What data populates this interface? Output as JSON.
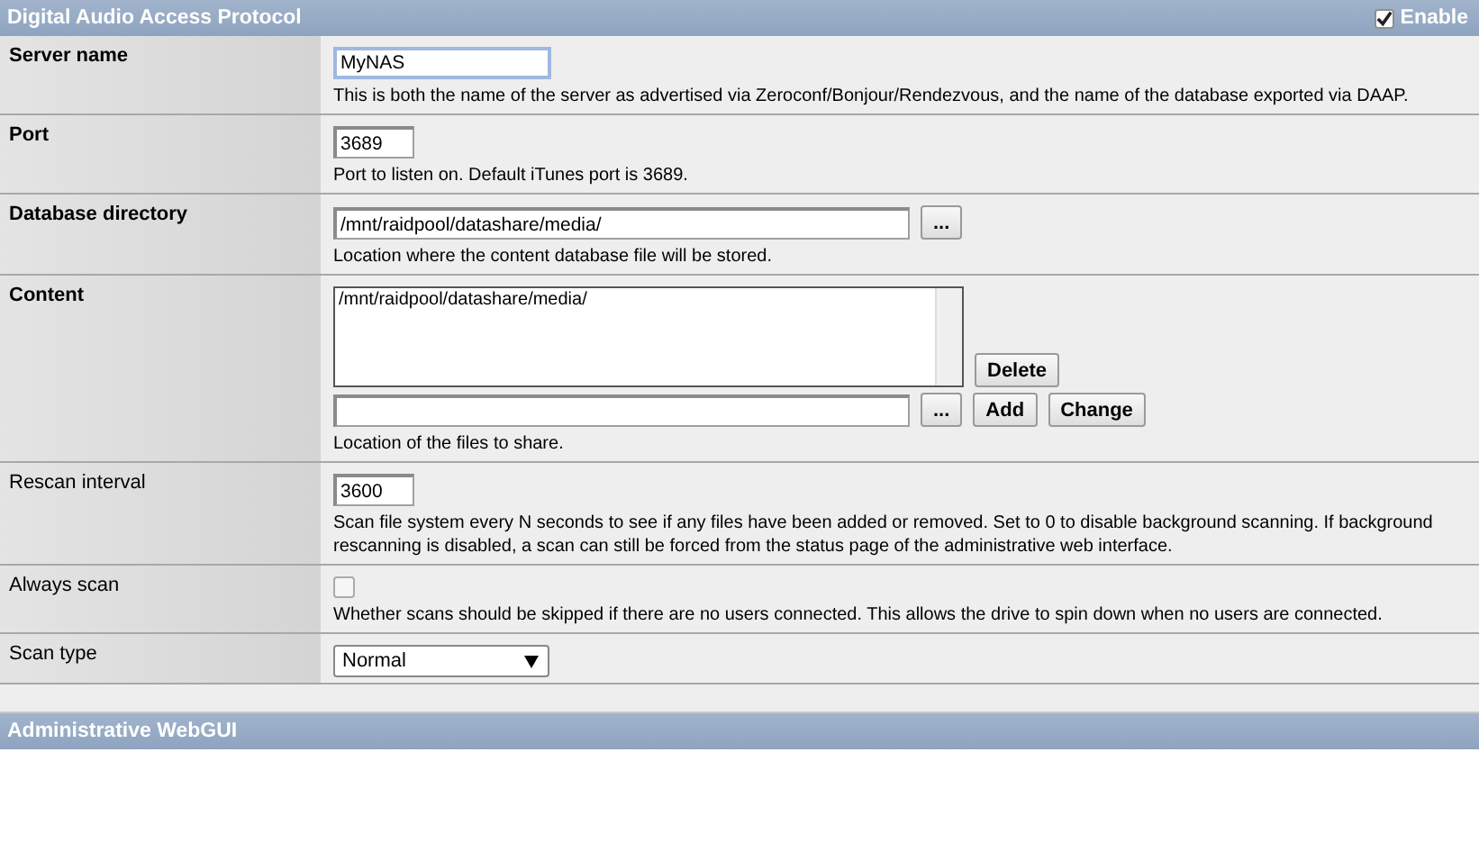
{
  "sections": [
    {
      "title": "Digital Audio Access Protocol",
      "enable": {
        "label": "Enable",
        "checked": true
      },
      "rows": [
        {
          "label": "Server name",
          "bold": true,
          "kind": "text",
          "value": "MyNAS",
          "focused": true,
          "description": "This is both the name of the server as advertised via Zeroconf/Bonjour/Rendezvous, and the name of the database exported via DAAP."
        },
        {
          "label": "Port",
          "bold": true,
          "kind": "short",
          "value": "3689",
          "focused": false,
          "description": "Port to listen on. Default iTunes port is 3689."
        },
        {
          "label": "Database directory",
          "bold": true,
          "kind": "path",
          "value": "/mnt/raidpool/datashare/media/",
          "browse": "...",
          "description": "Location where the content database file will be stored."
        },
        {
          "label": "Content",
          "bold": true,
          "kind": "list",
          "items": [
            "/mnt/raidpool/datashare/media/"
          ],
          "delete": "Delete",
          "browse": "...",
          "add": "Add",
          "change": "Change",
          "description": "Location of the files to share."
        },
        {
          "label": "Rescan interval",
          "bold": false,
          "kind": "short",
          "value": "3600",
          "focused": false,
          "description": "Scan file system every N seconds to see if any files have been added or removed. Set to 0 to disable background scanning. If background rescanning is disabled, a scan can still be forced from the status page of the administrative web interface."
        },
        {
          "label": "Always scan",
          "bold": false,
          "kind": "checkbox",
          "checked": false,
          "description": "Whether scans should be skipped if there are no users connected. This allows the drive to spin down when no users are connected."
        },
        {
          "label": "Scan type",
          "bold": false,
          "kind": "select",
          "value": "Normal"
        }
      ]
    },
    {
      "title": "Administrative WebGUI"
    }
  ]
}
